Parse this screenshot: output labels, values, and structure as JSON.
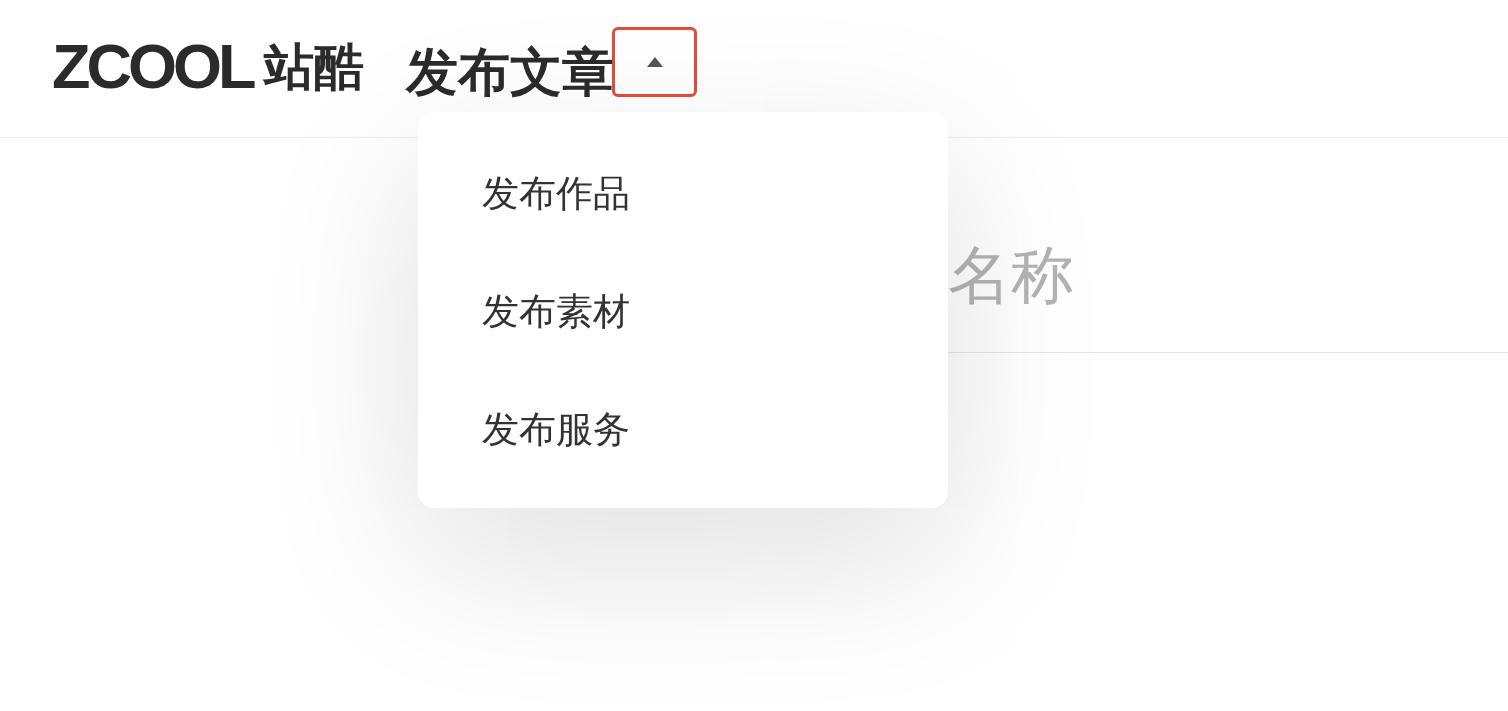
{
  "header": {
    "logo": {
      "wordmark": "ZCOOL",
      "name": "站酷"
    },
    "title": "发布文章",
    "menu_toggle": {
      "expanded": true,
      "highlighted": true
    }
  },
  "title_field": {
    "placeholder": "名称"
  },
  "dropdown_menu": {
    "items": [
      {
        "label": "发布作品"
      },
      {
        "label": "发布素材"
      },
      {
        "label": "发布服务"
      }
    ]
  }
}
